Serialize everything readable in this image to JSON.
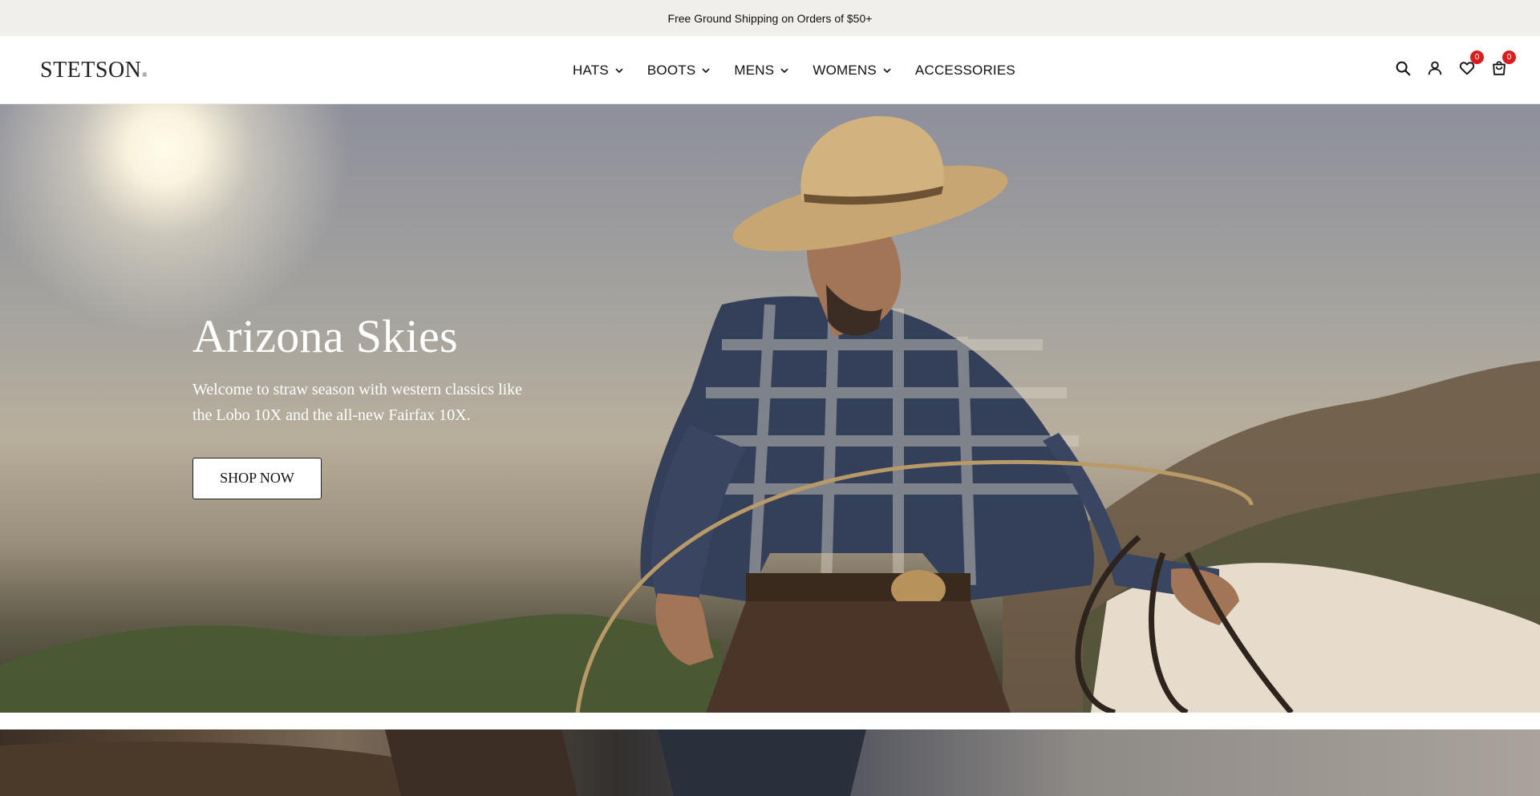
{
  "promo": {
    "text": "Free Ground Shipping on Orders of $50+"
  },
  "header": {
    "logo": "STETSON",
    "logo_mark": "®",
    "nav": [
      {
        "label": "HATS",
        "has_dropdown": true
      },
      {
        "label": "BOOTS",
        "has_dropdown": true
      },
      {
        "label": "MENS",
        "has_dropdown": true
      },
      {
        "label": "WOMENS",
        "has_dropdown": true
      },
      {
        "label": "ACCESSORIES",
        "has_dropdown": false
      }
    ],
    "icons": {
      "search": "search-icon",
      "account": "account-icon",
      "wishlist": "heart-icon",
      "cart": "cart-icon"
    },
    "wishlist_count": "0",
    "cart_count": "0"
  },
  "hero": {
    "title": "Arizona Skies",
    "subtitle": "Welcome to straw season with western classics like the Lobo 10X and the all-new Fairfax 10X.",
    "cta_label": "SHOP NOW"
  },
  "colors": {
    "promo_bg": "#f1efeb",
    "badge": "#d81e1e",
    "text": "#111111"
  }
}
